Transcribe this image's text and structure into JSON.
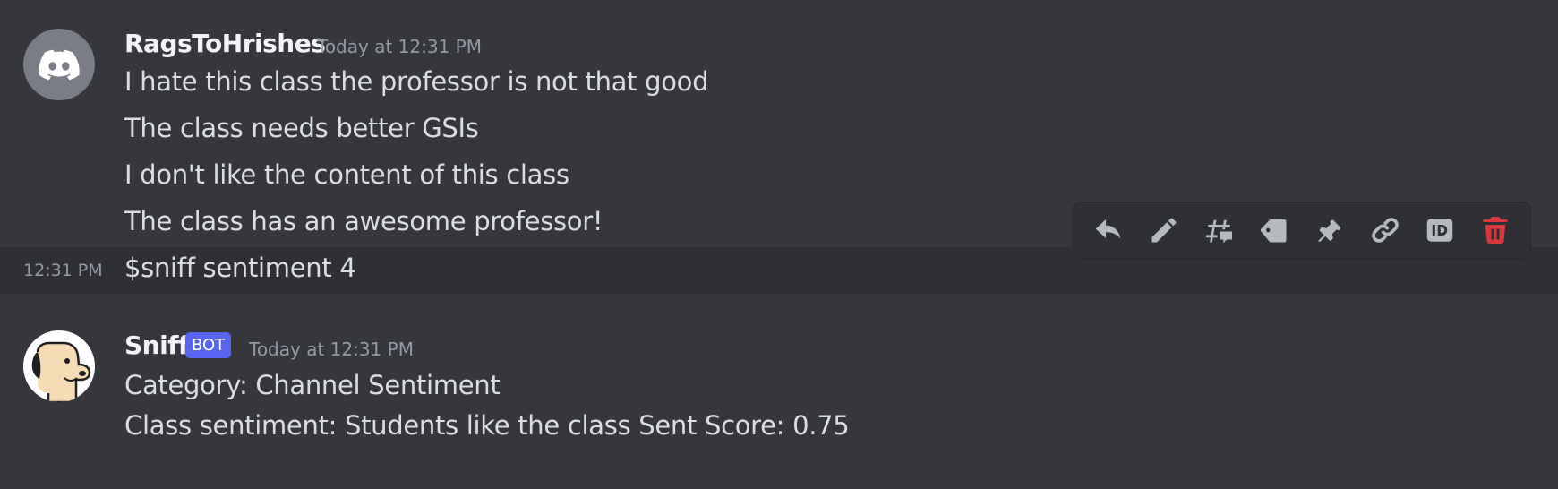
{
  "messages": [
    {
      "author": "RagsToHrishes",
      "timestamp": "Today at 12:31 PM",
      "lines": [
        "I hate this class the professor is not that good",
        "The class needs better GSIs",
        "I don't like the content of this class",
        "The class has an awesome professor!"
      ],
      "followup": {
        "time": "12:31 PM",
        "text": "$sniff sentiment 4"
      }
    },
    {
      "author": "Sniff",
      "badge": "BOT",
      "timestamp": "Today at 12:31 PM",
      "lines": [
        "Category: Channel Sentiment",
        "Class sentiment: Students like the class Sent Score: 0.75"
      ]
    }
  ],
  "toolbar": {
    "icons": [
      "reply-icon",
      "edit-icon",
      "create-thread-icon",
      "tag-icon",
      "pin-icon",
      "copy-link-icon",
      "copy-id-icon",
      "delete-icon"
    ],
    "colors": {
      "default": "#b5bac1",
      "danger": "#da373c"
    }
  }
}
